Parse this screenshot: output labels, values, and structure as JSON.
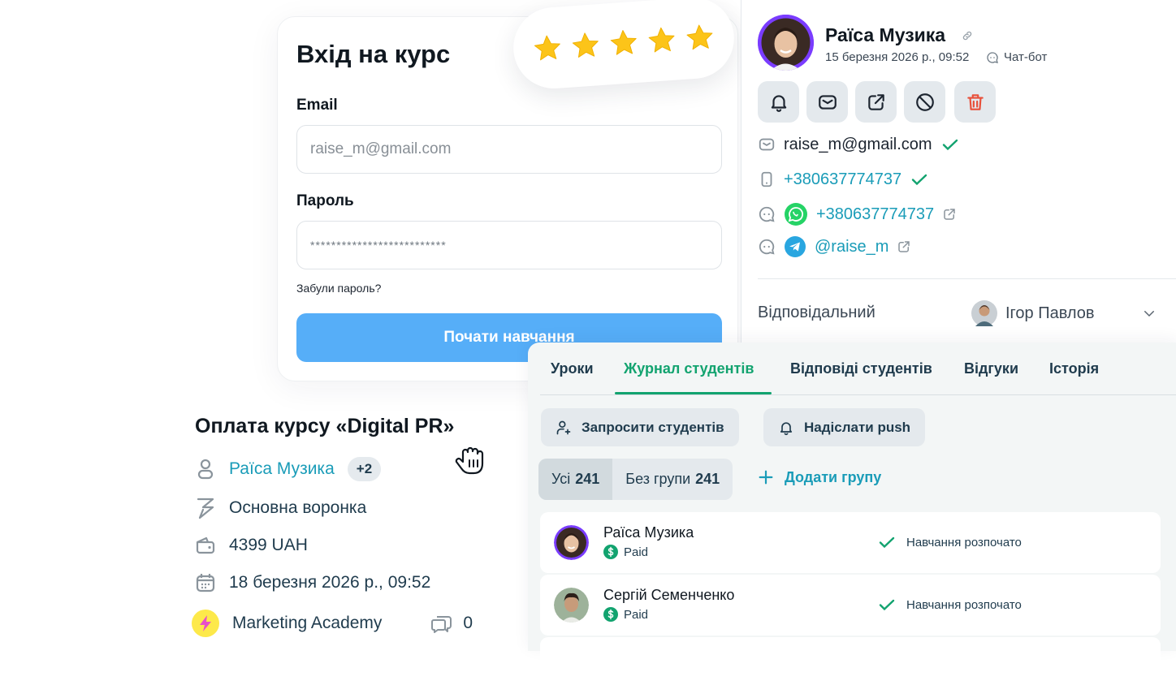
{
  "login": {
    "title": "Вхід на курс",
    "email_label": "Email",
    "email_value": "raise_m@gmail.com",
    "password_label": "Пароль",
    "password_value": "**************************",
    "forgot": "Забули пароль?",
    "start_button": "Почати навчання"
  },
  "rating": {
    "stars": 5,
    "max": 5,
    "color": "#fcc419"
  },
  "profile": {
    "name": "Раїса Музика",
    "date": "15 березня 2026 р., 09:52",
    "source": "Чат-бот",
    "actions": [
      "bell-icon",
      "mail-icon",
      "external-link-icon",
      "block-icon",
      "trash-icon"
    ],
    "email": "raise_m@gmail.com",
    "phone": "+380637774737",
    "whatsapp": "+380637774737",
    "telegram": "@raise_m",
    "responsible_label": "Відповідальний",
    "responsible_name": "Ігор Павлов"
  },
  "payment": {
    "title": "Оплата курсу «Digital PR»",
    "customer": "Раїса Музика",
    "extra_count": "+2",
    "funnel": "Основна воронка",
    "amount": "4399 UAH",
    "date": "18 березня 2026 р., 09:52",
    "organization": "Marketing Academy",
    "comments": "0"
  },
  "students": {
    "tabs": [
      "Уроки",
      "Журнал студентів",
      "Відповіді студентів",
      "Відгуки",
      "Історія"
    ],
    "active_tab": "Журнал студентів",
    "invite_button": "Запросити студентів",
    "push_button": "Надіслати push",
    "filters": [
      {
        "label": "Усі",
        "count": "241"
      },
      {
        "label": "Без групи",
        "count": "241"
      }
    ],
    "add_group": "Додати групу",
    "rows": [
      {
        "name": "Раїса Музика",
        "payment": "Paid",
        "status": "Навчання розпочато"
      },
      {
        "name": "Сергій Семенченко",
        "payment": "Paid",
        "status": "Навчання розпочато"
      }
    ]
  },
  "colors": {
    "accent_green": "#12a36f",
    "link": "#1a9cb8",
    "button_blue": "#56aef8",
    "danger": "#e8503a"
  }
}
